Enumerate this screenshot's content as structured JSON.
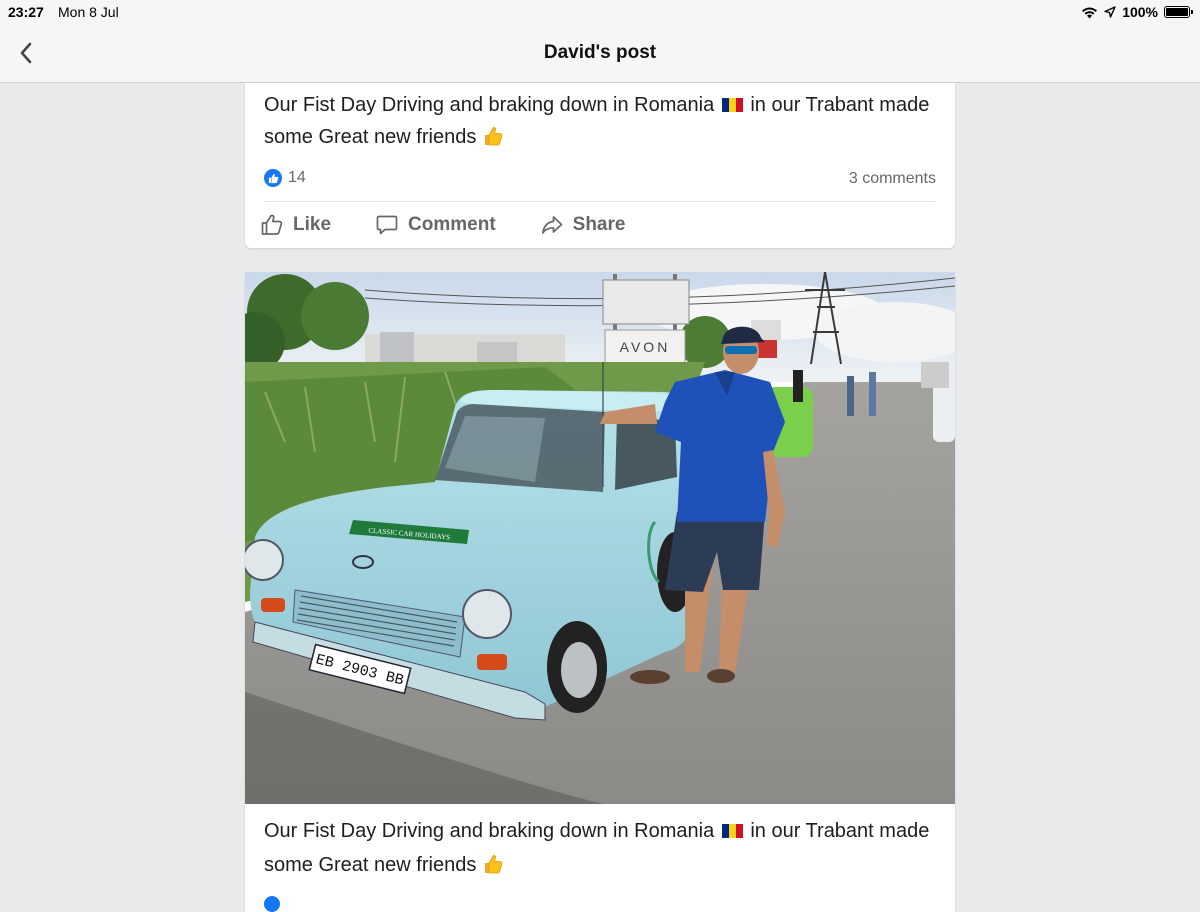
{
  "status_bar": {
    "time": "23:27",
    "date": "Mon 8 Jul",
    "battery": "100%",
    "battery_level": 1.0
  },
  "navbar": {
    "title": "David's post",
    "back_icon": "chevron-left-icon"
  },
  "post1": {
    "text_before_flag": "Our Fist Day Driving and braking down in Romania",
    "text_after_flag": " in our Trabant made some Great new friends",
    "flag_emoji": "romania-flag",
    "end_emoji": "thumbs-up",
    "likes": "14",
    "comments": "3 comments",
    "actions": {
      "like": "Like",
      "comment": "Comment",
      "share": "Share"
    }
  },
  "post2": {
    "text_before_flag": "Our Fist Day Driving and braking down in Romania",
    "text_after_flag": " in our Trabant made some Great new friends",
    "flag_emoji": "romania-flag",
    "end_emoji": "thumbs-up",
    "photo": {
      "sign_top": "AVON",
      "hood_banner": "CLASSIC CAR HOLIDAYS",
      "license_plate": "EB 2903 BB"
    }
  },
  "colors": {
    "accent": "#1877f2",
    "car": "#9fd3df",
    "flag_blue": "#002b7f",
    "flag_yellow": "#fcd116",
    "flag_red": "#ce1126"
  }
}
